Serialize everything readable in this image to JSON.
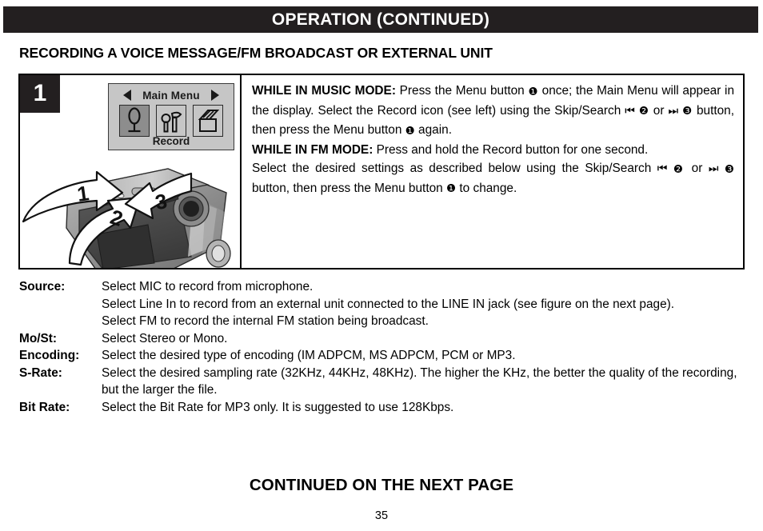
{
  "header": {
    "title": "OPERATION (CONTINUED)"
  },
  "section": {
    "heading": "RECORDING A VOICE MESSAGE/FM BROADCAST OR EXTERNAL UNIT"
  },
  "step": {
    "number": "1",
    "lcd": {
      "title": "Main Menu",
      "left_arrow": "left-triangle-icon",
      "right_arrow": "right-triangle-icon",
      "selected_label": "Record",
      "icons": [
        {
          "name": "microphone-record-icon",
          "selected": true
        },
        {
          "name": "settings-tools-icon",
          "selected": false
        },
        {
          "name": "files-folder-icon",
          "selected": false
        }
      ]
    },
    "device": {
      "callouts": [
        "1",
        "2",
        "3"
      ]
    },
    "paragraphs": [
      {
        "lead": "WHILE IN MUSIC MODE:",
        "text_1": " Press the Menu button ",
        "marker_1": "❶",
        "text_2": " once; the Main Menu will appear in the display. Select the Record icon (see left) using the Skip/Search ",
        "glyph_prev": "⏮",
        "marker_2": "❷",
        "text_3": " or ",
        "glyph_next": "⏭",
        "marker_3": "❸",
        "text_4": " button, then press the Menu button ",
        "marker_4": "❶",
        "text_5": " again."
      },
      {
        "lead": "WHILE IN FM MODE:",
        "text_1": " Press and hold the Record button for one second.",
        "text_2": "",
        "text_3": "",
        "text_4": "",
        "text_5": ""
      },
      {
        "lead": "",
        "text_1": "Select the desired settings as described below using the Skip/Search ",
        "glyph_prev": "⏮",
        "marker_2": "❷",
        "text_3": " or ",
        "glyph_next": "⏭",
        "marker_3": "❸",
        "text_4": " button, then press the Menu button ",
        "marker_4": "❶",
        "text_5": " to change."
      }
    ]
  },
  "settings": [
    {
      "term": "Source:",
      "lines": [
        "Select MIC to record from microphone.",
        "Select Line In to record from an external unit connected to the LINE IN jack (see figure on the next page).",
        "Select FM to record the internal FM station being broadcast."
      ]
    },
    {
      "term": "Mo/St:",
      "lines": [
        "Select Stereo or Mono."
      ]
    },
    {
      "term": "Encoding:",
      "lines": [
        "Select the desired type of encoding (IM ADPCM, MS ADPCM, PCM or MP3."
      ]
    },
    {
      "term": "S-Rate:",
      "lines": [
        "Select the desired sampling rate (32KHz, 44KHz, 48KHz). The higher the KHz, the better the quality of the recording, but the larger the file."
      ]
    },
    {
      "term": "Bit Rate:",
      "lines": [
        "Select the Bit Rate for MP3 only. It is suggested to use 128Kbps."
      ]
    }
  ],
  "footer": {
    "continued": "CONTINUED ON THE NEXT PAGE",
    "page": "35"
  },
  "colors": {
    "header_bg": "#231f20",
    "header_text": "#ffffff",
    "lcd_bg": "#c6c6c6",
    "lcd_selected": "#8d8d8d",
    "border": "#000000",
    "page_bg": "#ffffff"
  }
}
